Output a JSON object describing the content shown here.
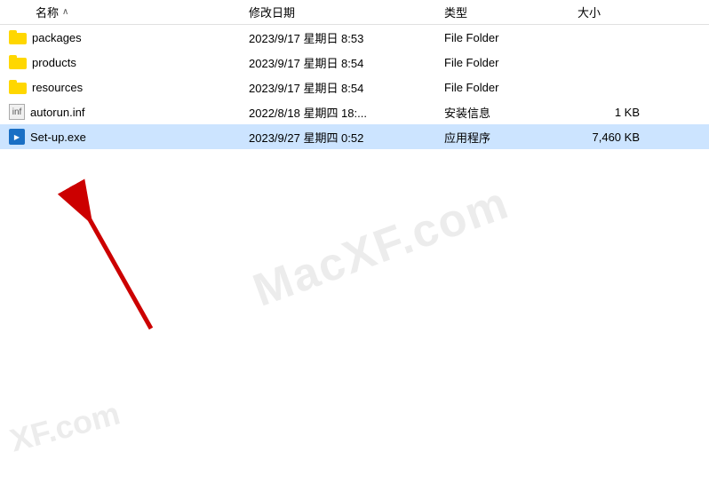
{
  "header": {
    "col_name": "名称",
    "col_date": "修改日期",
    "col_type": "类型",
    "col_size": "大小",
    "sort_arrow": "∧"
  },
  "files": [
    {
      "name": "packages",
      "type_icon": "folder",
      "date": "2023/9/17 星期日 8:53",
      "file_type": "File Folder",
      "size": "",
      "selected": false
    },
    {
      "name": "products",
      "type_icon": "folder",
      "date": "2023/9/17 星期日 8:54",
      "file_type": "File Folder",
      "size": "",
      "selected": false
    },
    {
      "name": "resources",
      "type_icon": "folder",
      "date": "2023/9/17 星期日 8:54",
      "file_type": "File Folder",
      "size": "",
      "selected": false
    },
    {
      "name": "autorun.inf",
      "type_icon": "inf",
      "date": "2022/8/18 星期四 18:...",
      "file_type": "安装信息",
      "size": "1 KB",
      "selected": false
    },
    {
      "name": "Set-up.exe",
      "type_icon": "exe",
      "date": "2023/9/27 星期四 0:52",
      "file_type": "应用程序",
      "size": "7,460 KB",
      "selected": true
    }
  ],
  "watermark": {
    "main": "MacXF.com",
    "bottom": "XF.com"
  }
}
